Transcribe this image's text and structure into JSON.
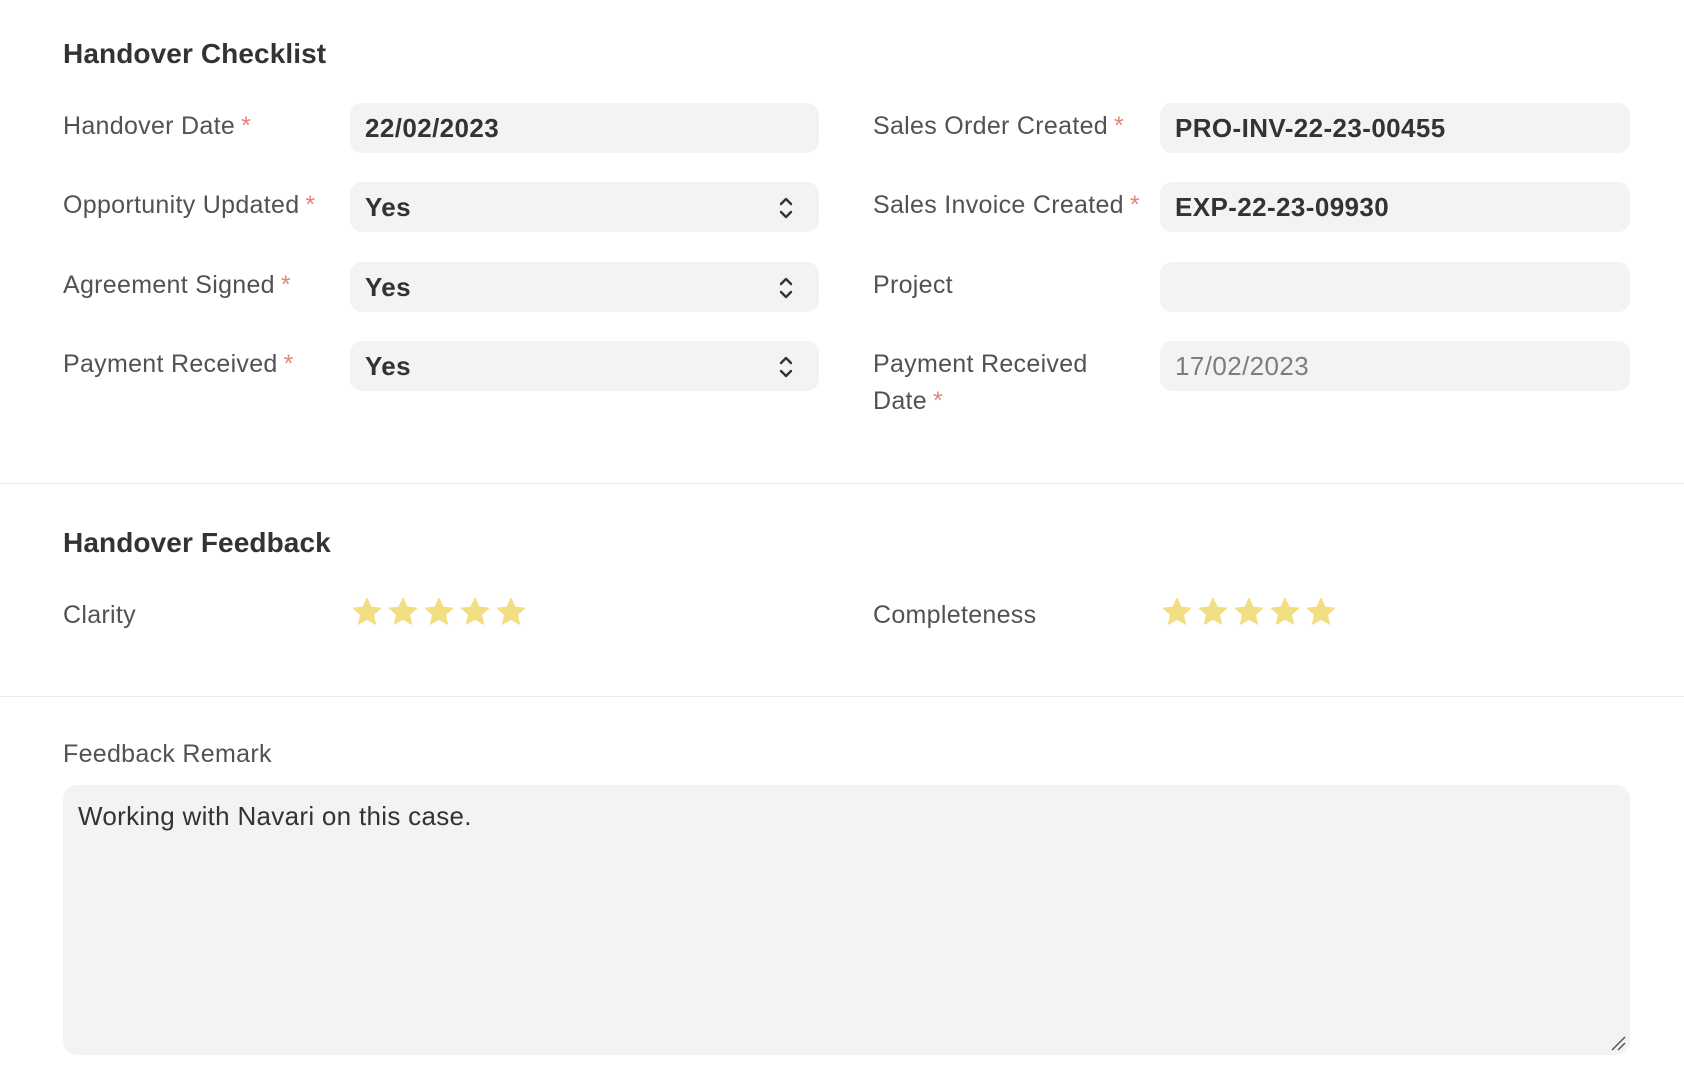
{
  "checklist": {
    "title": "Handover Checklist",
    "handover_date": {
      "label": "Handover Date",
      "required": "*",
      "value": "22/02/2023"
    },
    "opportunity_updated": {
      "label": "Opportunity Updated",
      "required": "*",
      "value": "Yes"
    },
    "agreement_signed": {
      "label": "Agreement Signed",
      "required": "*",
      "value": "Yes"
    },
    "payment_received": {
      "label": "Payment Received",
      "required": "*",
      "value": "Yes"
    },
    "sales_order_created": {
      "label": "Sales Order Created",
      "required": "*",
      "value": "PRO-INV-22-23-00455"
    },
    "sales_invoice_created": {
      "label": "Sales Invoice Created",
      "required": "*",
      "value": "EXP-22-23-09930"
    },
    "project": {
      "label": "Project",
      "value": ""
    },
    "payment_received_date": {
      "label_line1": "Payment Received",
      "label_line2": "Date",
      "required": "*",
      "value": "17/02/2023"
    }
  },
  "feedback": {
    "title": "Handover Feedback",
    "clarity": {
      "label": "Clarity",
      "rating": 5,
      "max": 5
    },
    "completeness": {
      "label": "Completeness",
      "rating": 5,
      "max": 5
    },
    "star_color": "#f2df84"
  },
  "remark": {
    "label": "Feedback Remark",
    "value": "Working with Navari on this case."
  },
  "colors": {
    "required": "#e0857a",
    "field_bg": "#f3f3f3",
    "divider": "#ebebeb"
  }
}
